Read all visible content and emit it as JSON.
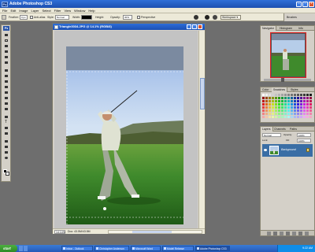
{
  "app": {
    "title": "Adobe Photoshop CS3",
    "logo_text": "Ps"
  },
  "menubar": {
    "items": [
      "File",
      "Edit",
      "Image",
      "Layer",
      "Select",
      "Filter",
      "View",
      "Window",
      "Help"
    ]
  },
  "options": {
    "feather_label": "Feather:",
    "feather_value": "0 px",
    "antialias_label": "Anti-alias",
    "style_label": "Style:",
    "style_value": "Normal",
    "width_label": "Width:",
    "height_label": "Height:",
    "perspective_label": "Perspective",
    "opacity_label": "Opacity:",
    "opacity_value": "30%",
    "workspace_label": "Workspace ▾",
    "brushes_tab": "Brushes"
  },
  "document": {
    "title": "Triangle3034.JPG @ 14.1% (RGB/8)",
    "zoom": "14.14%",
    "info": "Doc: 43.5M/43.5M"
  },
  "navigator": {
    "tabs": [
      "Navigator",
      "Histogram",
      "Info"
    ],
    "zoom": "14.14%"
  },
  "color_panel": {
    "tabs": [
      "Color",
      "Swatches",
      "Styles"
    ]
  },
  "layers": {
    "tabs": [
      "Layers",
      "Channels",
      "Paths"
    ],
    "blend_mode": "Normal",
    "opacity_label": "Opacity:",
    "opacity_value": "100%",
    "lock_label": "Lock:",
    "fill_label": "Fill:",
    "fill_value": "100%",
    "layer_name": "Background"
  },
  "taskbar": {
    "start_label": "start",
    "items": [
      {
        "label": "Inbox - Outlook"
      },
      {
        "label": "Christopher Anderson"
      },
      {
        "label": "Microsoft Word"
      },
      {
        "label": "Model Release"
      },
      {
        "label": "Adobe Photoshop CS3"
      }
    ],
    "clock": "9:22 AM"
  },
  "colors": {
    "title_blue": "#1c4fb0",
    "sky_top": "#9fbde8",
    "sky_bottom": "#d6e4f1",
    "grass": "#3f8a2c",
    "hills": "#5a6b3e",
    "shirt": "#d8dccb",
    "pants": "#a8b0a0",
    "layer_highlight": "#3a6ea5"
  }
}
